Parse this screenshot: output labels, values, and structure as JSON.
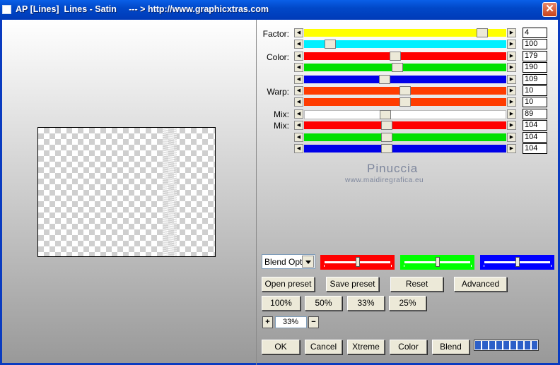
{
  "window": {
    "title": "AP [Lines]  Lines - Satin     --- > http://www.graphicxtras.com",
    "close_label": "✕"
  },
  "labels": {
    "factor": "Factor:",
    "color": "Color:",
    "warp": "Warp:",
    "mix1": "Mix:",
    "mix2": "Mix:"
  },
  "sliders": [
    {
      "value": "4",
      "level": 0.88,
      "color": "#ffff00"
    },
    {
      "value": "100",
      "level": 0.13,
      "color": "#00f0ff"
    },
    {
      "value": "179",
      "level": 0.45,
      "color": "#ff0000"
    },
    {
      "value": "190",
      "level": 0.46,
      "color": "#00e000"
    },
    {
      "value": "109",
      "level": 0.4,
      "color": "#0000e8"
    },
    {
      "value": "10",
      "level": 0.5,
      "color": "#ff3c00"
    },
    {
      "value": "10",
      "level": 0.5,
      "color": "#ff3c00"
    },
    {
      "value": "89",
      "level": 0.4,
      "color": "#ffffff"
    },
    {
      "value": "104",
      "level": 0.41,
      "color": "#ff0000"
    },
    {
      "value": "104",
      "level": 0.41,
      "color": "#00e000"
    },
    {
      "value": "104",
      "level": 0.41,
      "color": "#0000e8"
    }
  ],
  "watermark": {
    "name": "Pinuccia",
    "site": "www.maidiregrafica.eu"
  },
  "blend": {
    "combo_text": "Blend Optio",
    "panels": [
      {
        "color": "#ff0000",
        "level": 0.5
      },
      {
        "color": "#00ff00",
        "level": 0.5
      },
      {
        "color": "#0000ff",
        "level": 0.5
      }
    ]
  },
  "buttons": {
    "open_preset": "Open preset",
    "save_preset": "Save preset",
    "reset": "Reset",
    "advanced": "Advanced",
    "z100": "100%",
    "z50": "50%",
    "z33": "33%",
    "z25": "25%",
    "ok": "OK",
    "cancel": "Cancel",
    "xtreme": "Xtreme",
    "color": "Color",
    "blend": "Blend"
  },
  "zoom": {
    "plus": "+",
    "value": "33%",
    "minus": "−"
  },
  "progress_level": 1.0
}
